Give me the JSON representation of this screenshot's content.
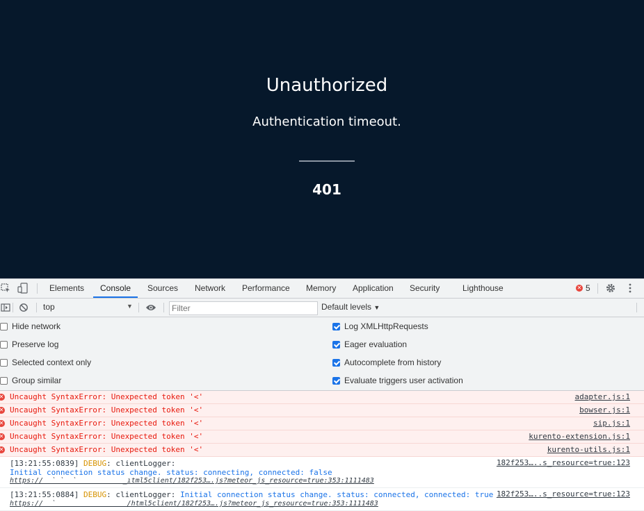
{
  "page": {
    "title": "Unauthorized",
    "subtitle": "Authentication timeout.",
    "code": "401"
  },
  "devtools": {
    "tabs": [
      "Elements",
      "Console",
      "Sources",
      "Network",
      "Performance",
      "Memory",
      "Application",
      "Security",
      "Lighthouse"
    ],
    "active_tab": "Console",
    "error_count": "5",
    "context": "top",
    "filter_placeholder": "Filter",
    "levels_label": "Default levels",
    "settings_left": [
      {
        "label": "Hide network",
        "checked": false
      },
      {
        "label": "Preserve log",
        "checked": false
      },
      {
        "label": "Selected context only",
        "checked": false
      },
      {
        "label": "Group similar",
        "checked": false
      }
    ],
    "settings_right": [
      {
        "label": "Log XMLHttpRequests",
        "checked": true
      },
      {
        "label": "Eager evaluation",
        "checked": true
      },
      {
        "label": "Autocomplete from history",
        "checked": true
      },
      {
        "label": "Evaluate triggers user activation",
        "checked": true
      }
    ],
    "errors": [
      {
        "message": "Uncaught SyntaxError: Unexpected token '<'",
        "source": "adapter.js:1"
      },
      {
        "message": "Uncaught SyntaxError: Unexpected token '<'",
        "source": "bowser.js:1"
      },
      {
        "message": "Uncaught SyntaxError: Unexpected token '<'",
        "source": "sip.js:1"
      },
      {
        "message": "Uncaught SyntaxError: Unexpected token '<'",
        "source": "kurento-extension.js:1"
      },
      {
        "message": "Uncaught SyntaxError: Unexpected token '<'",
        "source": "kurento-utils.js:1"
      }
    ],
    "logs": [
      {
        "time": "[13:21:55:0839]",
        "level": "DEBUG",
        "logger": ": clientLogger:",
        "message": "Initial connection status change. status: connecting, connected: false",
        "link": "https://  ` `  `           _ıtml5client/182f253….js?meteor_js_resource=true:353:1111483",
        "source": "182f253…..s_resource=true:123"
      },
      {
        "time": "[13:21:55:0884]",
        "level": "DEBUG",
        "logger": ": clientLogger:",
        "message": "Initial connection status change. status: connected, connected: true",
        "link": "https://  `                 /html5client/182f253….js?meteor_js_resource=true:353:1111483",
        "source": "182f253…..s_resource=true:123"
      }
    ]
  }
}
